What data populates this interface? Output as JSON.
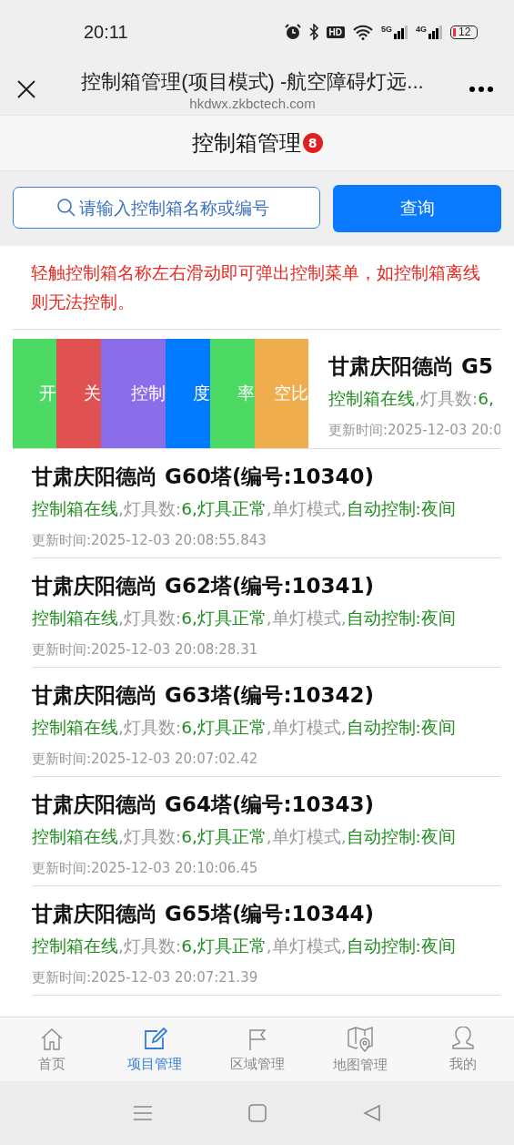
{
  "status_bar": {
    "time": "20:11",
    "hd": "HD",
    "networks": [
      "5G",
      "4G"
    ],
    "battery": "12"
  },
  "browser_bar": {
    "title": "控制箱管理(项目模式) -航空障碍灯远...",
    "url": "hkdwx.zkbctech.com"
  },
  "header": {
    "title": "控制箱管理",
    "badge": "8"
  },
  "search": {
    "placeholder": "请输入控制箱名称或编号",
    "button": "查询"
  },
  "notice": "轻触控制箱名称左右滑动即可弹出控制菜单，如控制箱离线则无法控制。",
  "swiped_row": {
    "actions": [
      {
        "label": "开",
        "color": "#4cd964"
      },
      {
        "label": "关",
        "color": "#e05252"
      },
      {
        "label": "控制",
        "color": "#8a6de9"
      },
      {
        "label": "度",
        "color": "#007aff"
      },
      {
        "label": "率",
        "color": "#4cd964"
      },
      {
        "label": "空比",
        "color": "#f0ad4e"
      }
    ],
    "title": "甘肃庆阳德尚 G5",
    "status": [
      {
        "text": "控制箱在线",
        "color": "#1f8f1f"
      },
      {
        "text": ",灯具数:",
        "color": "#9a9a9a"
      },
      {
        "text": "6,",
        "color": "#1f8f1f"
      }
    ],
    "time": "更新时间:2025-12-03 20:0"
  },
  "rows": [
    {
      "title": "甘肃庆阳德尚 G60塔(编号:10340)",
      "status": [
        {
          "text": "控制箱在线",
          "color": "#1f8f1f"
        },
        {
          "text": ",灯具数:",
          "color": "#9a9a9a"
        },
        {
          "text": "6,灯具正常",
          "color": "#1f8f1f"
        },
        {
          "text": ",单灯模式,",
          "color": "#9a9a9a"
        },
        {
          "text": "自动控制:夜间",
          "color": "#1f8f1f"
        }
      ],
      "time": "更新时间:2025-12-03 20:08:55.843"
    },
    {
      "title": "甘肃庆阳德尚 G62塔(编号:10341)",
      "status": [
        {
          "text": "控制箱在线",
          "color": "#1f8f1f"
        },
        {
          "text": ",灯具数:",
          "color": "#9a9a9a"
        },
        {
          "text": "6,灯具正常",
          "color": "#1f8f1f"
        },
        {
          "text": ",单灯模式,",
          "color": "#9a9a9a"
        },
        {
          "text": "自动控制:夜间",
          "color": "#1f8f1f"
        }
      ],
      "time": "更新时间:2025-12-03 20:08:28.31"
    },
    {
      "title": "甘肃庆阳德尚 G63塔(编号:10342)",
      "status": [
        {
          "text": "控制箱在线",
          "color": "#1f8f1f"
        },
        {
          "text": ",灯具数:",
          "color": "#9a9a9a"
        },
        {
          "text": "6,灯具正常",
          "color": "#1f8f1f"
        },
        {
          "text": ",单灯模式,",
          "color": "#9a9a9a"
        },
        {
          "text": "自动控制:夜间",
          "color": "#1f8f1f"
        }
      ],
      "time": "更新时间:2025-12-03 20:07:02.42"
    },
    {
      "title": "甘肃庆阳德尚 G64塔(编号:10343)",
      "status": [
        {
          "text": "控制箱在线",
          "color": "#1f8f1f"
        },
        {
          "text": ",灯具数:",
          "color": "#9a9a9a"
        },
        {
          "text": "6,灯具正常",
          "color": "#1f8f1f"
        },
        {
          "text": ",单灯模式,",
          "color": "#9a9a9a"
        },
        {
          "text": "自动控制:夜间",
          "color": "#1f8f1f"
        }
      ],
      "time": "更新时间:2025-12-03 20:10:06.45"
    },
    {
      "title": "甘肃庆阳德尚 G65塔(编号:10344)",
      "status": [
        {
          "text": "控制箱在线",
          "color": "#1f8f1f"
        },
        {
          "text": ",灯具数:",
          "color": "#9a9a9a"
        },
        {
          "text": "6,灯具正常",
          "color": "#1f8f1f"
        },
        {
          "text": ",单灯模式,",
          "color": "#9a9a9a"
        },
        {
          "text": "自动控制:夜间",
          "color": "#1f8f1f"
        }
      ],
      "time": "更新时间:2025-12-03 20:07:21.39"
    }
  ],
  "tabs": [
    {
      "label": "首页",
      "selected": false
    },
    {
      "label": "项目管理",
      "selected": true
    },
    {
      "label": "区域管理",
      "selected": false
    },
    {
      "label": "地图管理",
      "selected": false
    },
    {
      "label": "我的",
      "selected": false
    }
  ]
}
